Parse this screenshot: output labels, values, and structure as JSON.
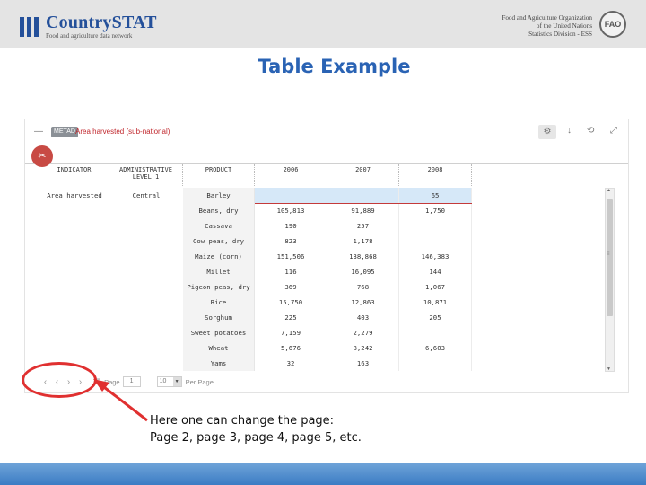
{
  "header": {
    "logo_title": "CountrySTAT",
    "logo_subtitle": "Food and agriculture data network",
    "org_lines": [
      "Food and Agriculture Organization",
      "of the United Nations",
      "Statistics Division - ESS"
    ],
    "org_logo_text": "FAO"
  },
  "slide_title": "Table Example",
  "widget": {
    "meta_label": "METAD",
    "title": "Area harvested (sub-national)",
    "columns": [
      "INDICATOR",
      "ADMINISTRATIVE LEVEL 1",
      "PRODUCT",
      "2006",
      "2007",
      "2008"
    ],
    "indicator": "Area harvested",
    "admin_level": "Central",
    "rows": [
      {
        "product": "Barley",
        "y2006": "",
        "y2007": "",
        "y2008": "65"
      },
      {
        "product": "Beans, dry",
        "y2006": "105,813",
        "y2007": "91,889",
        "y2008": "1,750"
      },
      {
        "product": "Cassava",
        "y2006": "190",
        "y2007": "257",
        "y2008": ""
      },
      {
        "product": "Cow peas, dry",
        "y2006": "823",
        "y2007": "1,178",
        "y2008": ""
      },
      {
        "product": "Maize (corn)",
        "y2006": "151,506",
        "y2007": "138,868",
        "y2008": "146,383"
      },
      {
        "product": "Millet",
        "y2006": "116",
        "y2007": "16,095",
        "y2008": "144"
      },
      {
        "product": "Pigeon peas, dry",
        "y2006": "369",
        "y2007": "768",
        "y2008": "1,067"
      },
      {
        "product": "Rice",
        "y2006": "15,750",
        "y2007": "12,863",
        "y2008": "10,871"
      },
      {
        "product": "Sorghum",
        "y2006": "225",
        "y2007": "403",
        "y2008": "205"
      },
      {
        "product": "Sweet potatoes",
        "y2006": "7,159",
        "y2007": "2,279",
        "y2008": ""
      },
      {
        "product": "Wheat",
        "y2006": "5,676",
        "y2007": "8,242",
        "y2008": "6,603"
      },
      {
        "product": "Yams",
        "y2006": "32",
        "y2007": "163",
        "y2008": ""
      }
    ],
    "pager": {
      "page_label": "Page",
      "page_value": "1",
      "per_page_value": "10",
      "per_page_label": "Per Page"
    }
  },
  "annotation": {
    "line1": "Here one can change the page:",
    "line2": "Page 2, page 3, page 4, page 5, etc."
  },
  "colors": {
    "brand_blue": "#24509a",
    "title_blue": "#2a63b4",
    "annotation_red": "#e03030",
    "fab_red": "#c84a44",
    "highlight": "#d6e8f8"
  }
}
